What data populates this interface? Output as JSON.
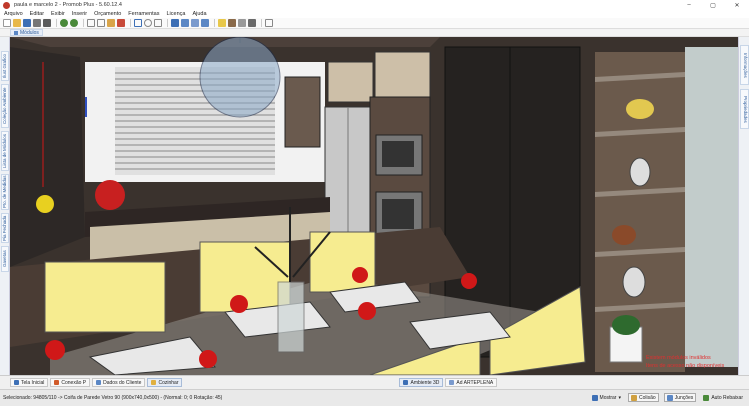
{
  "window": {
    "title": "paula e marcelo 2 - Promob Plus - 5.60.12.4",
    "controls": [
      "–",
      "▢",
      "✕"
    ]
  },
  "menu": [
    "Arquivo",
    "Editar",
    "Exibir",
    "Inserir",
    "Orçamento",
    "Ferramentas",
    "Licença",
    "Ajuda"
  ],
  "module_tab": {
    "label": "Módulos"
  },
  "left_tabs": [
    "Ilust Grafico",
    "Coleção Ambiente",
    "Lista de Módulos",
    "Pto. de Medidas",
    "Pia Fechada",
    "Gavetas"
  ],
  "right_tabs": [
    "Informações",
    "Propriedades"
  ],
  "viewport": {
    "messages": [
      "Existem módulos inválidos",
      "Itens de acesso não disponíveis"
    ]
  },
  "bottom_tabs": {
    "left": [
      "Tela Inicial",
      "Conexão P",
      "Dados do Cliente",
      "Cozinhar"
    ],
    "center": [
      "Ambiente 3D",
      "Ad ARTEPLENA"
    ]
  },
  "status": {
    "text": "Selecionado: 94805/110 -> Coifa de Parede Vetro 90 (900x740,0x500) - (Normal: 0; 0 Rotação: 45)",
    "mostrar": "Mostrar",
    "colisao": "Colisão",
    "juncoes": "Junções",
    "auto_rebaixar": "Auto Rebaixar"
  },
  "colors": {
    "accent": "#2a5a9a",
    "error": "#e03030",
    "wall": "#3c3430"
  }
}
